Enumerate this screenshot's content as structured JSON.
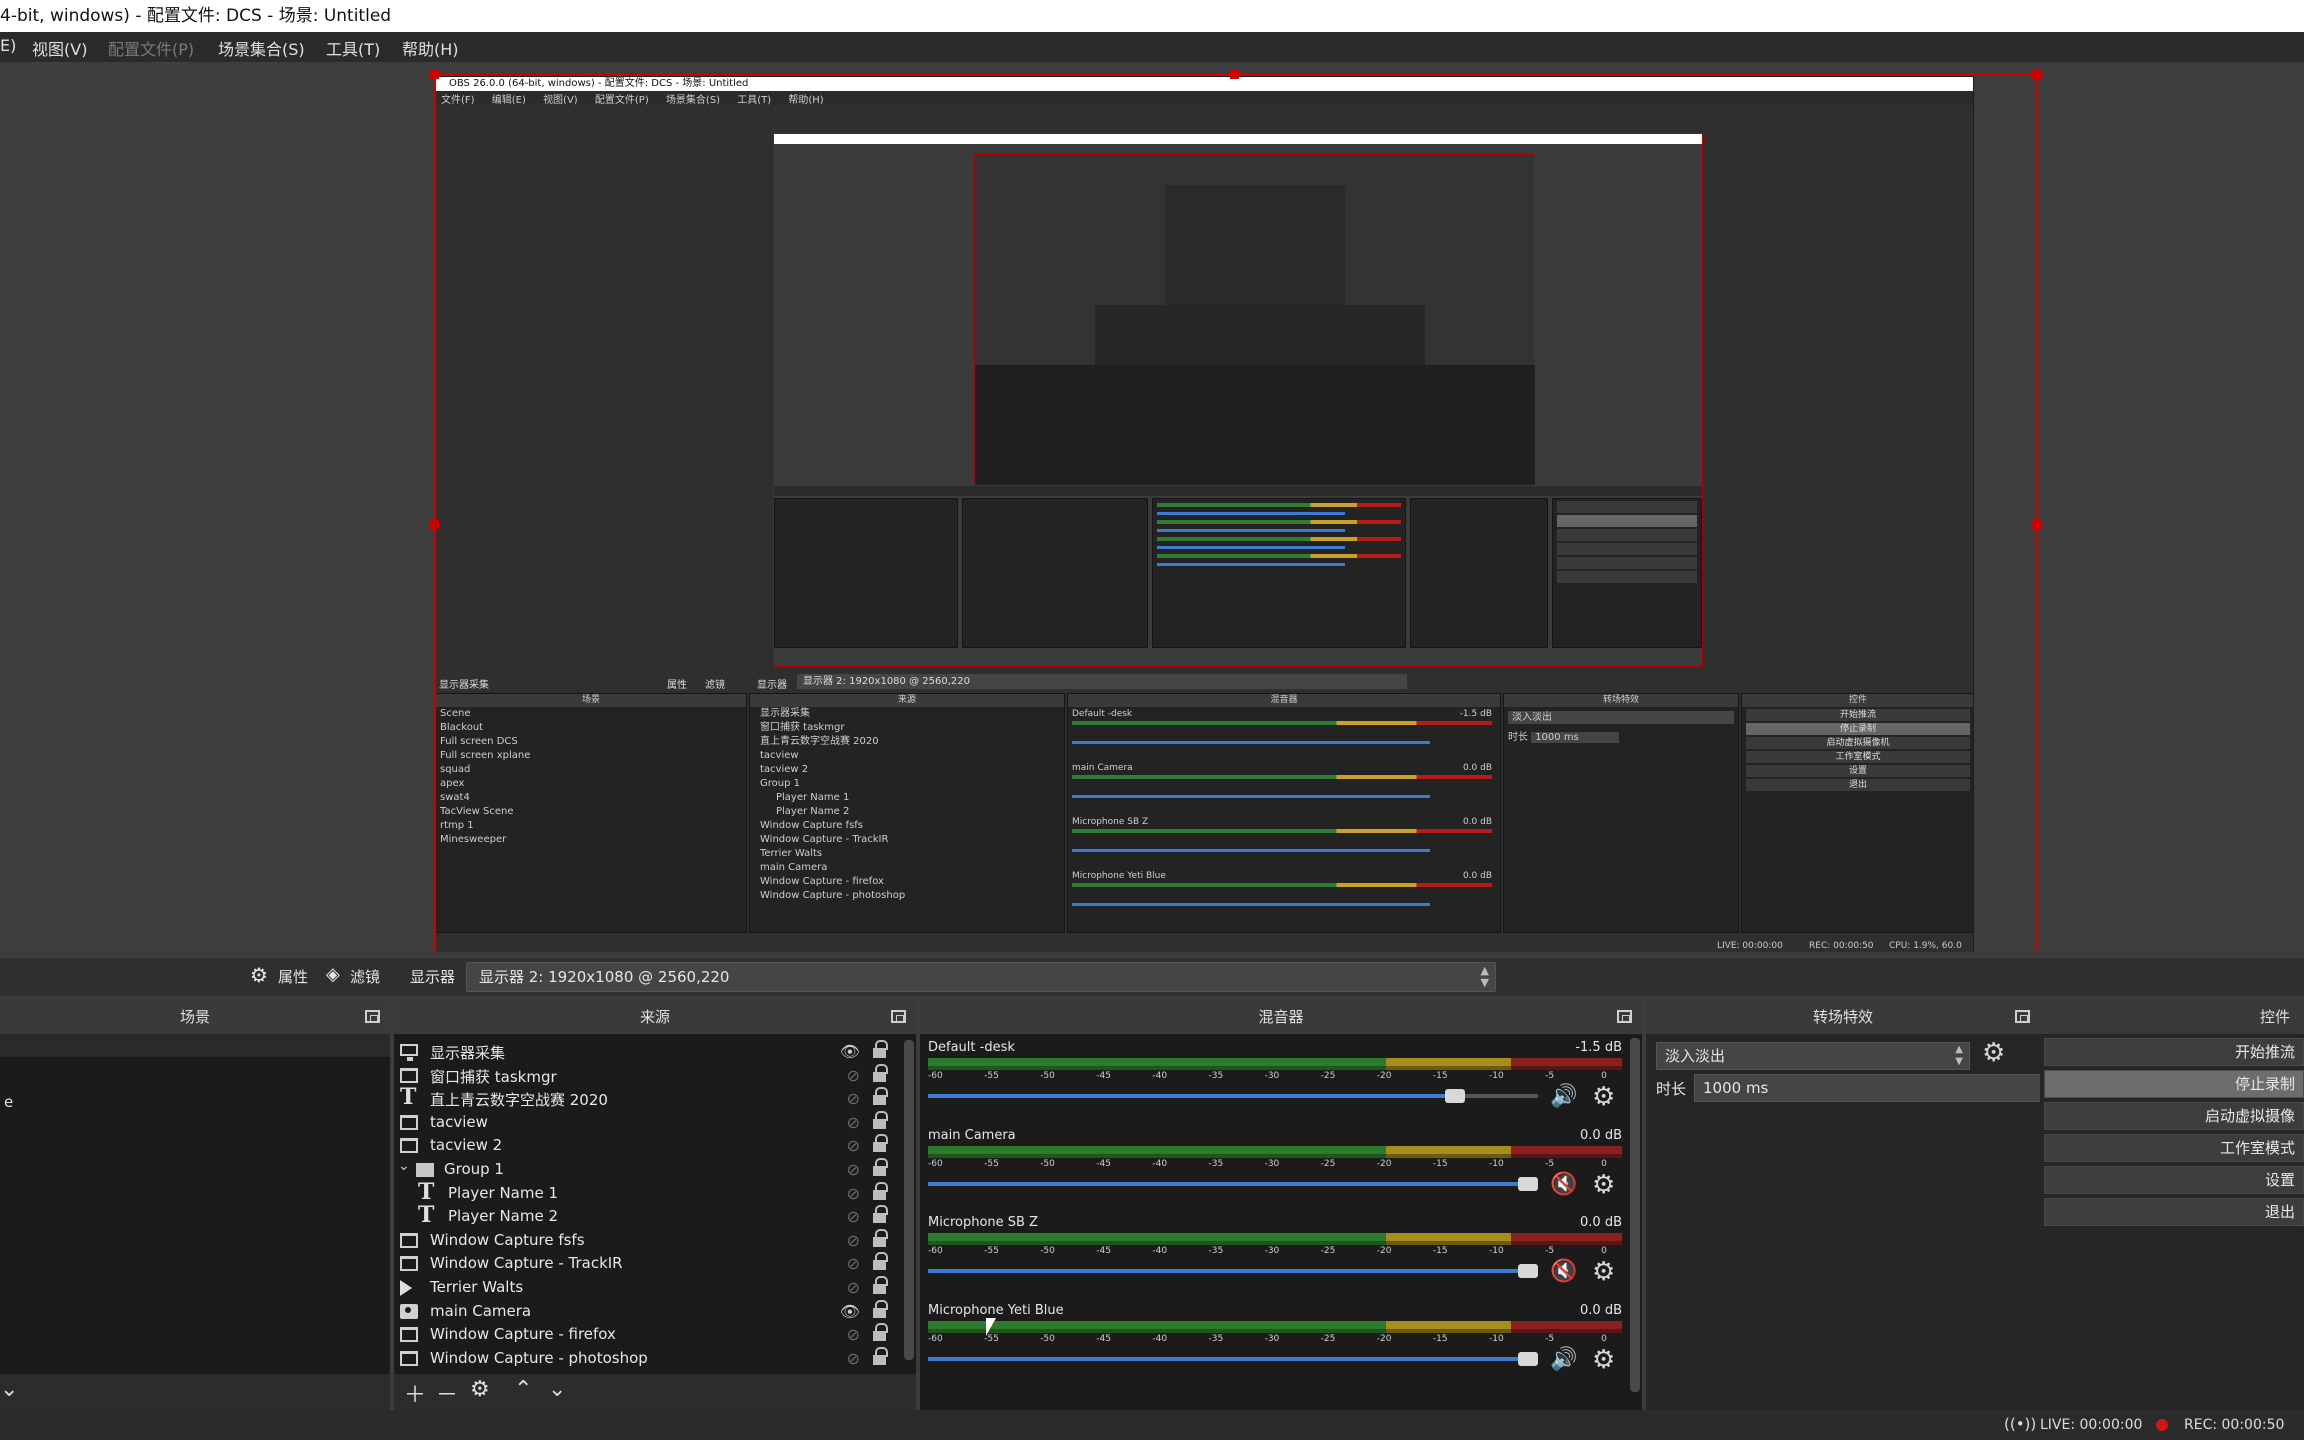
{
  "window": {
    "title": "4-bit, windows) - 配置文件: DCS - 场景: Untitled"
  },
  "menu": [
    {
      "label": "E)",
      "disabled": false
    },
    {
      "label": "视图(V)",
      "disabled": false
    },
    {
      "label": "配置文件(P)",
      "disabled": true
    },
    {
      "label": "场景集合(S)",
      "disabled": false
    },
    {
      "label": "工具(T)",
      "disabled": false
    },
    {
      "label": "帮助(H)",
      "disabled": false
    }
  ],
  "preview": {
    "nested_title": "OBS 26.0.0 (64-bit, windows) - 配置文件: DCS - 场景: Untitled",
    "nested_menu": [
      "文件(F)",
      "编辑(E)",
      "视图(V)",
      "配置文件(P)",
      "场景集合(S)",
      "工具(T)",
      "帮助(H)"
    ],
    "nested_toolbar": {
      "source": "显示器采集",
      "properties": "属性",
      "filters": "滤镜",
      "display": "显示器",
      "display_value": "显示器 2: 1920x1080 @ 2560,220"
    },
    "nested_headers": {
      "scenes": "场景",
      "sources": "来源",
      "mixer": "混音器",
      "transitions": "转场特效",
      "controls": "控件"
    },
    "nested_scenes": [
      "Scene",
      "Blackout",
      "Full screen DCS",
      "Full screen xplane",
      "squad",
      "apex",
      "swat4",
      "TacView    Scene",
      "rtmp 1",
      "Minesweeper"
    ],
    "nested_sources": [
      "显示器采集",
      "窗口捕获 taskmgr",
      "直上青云数字空战赛 2020",
      "tacview",
      "tacview 2",
      "Group 1",
      "Player Name 1",
      "Player Name 2",
      "Window Capture fsfs",
      "Window Capture - TrackIR",
      "Terrier Walts",
      "main Camera",
      "Window Capture - firefox",
      "Window Capture - photoshop"
    ],
    "nested_mixer": [
      {
        "name": "Default -desk",
        "db": "-1.5 dB"
      },
      {
        "name": "main Camera",
        "db": "0.0 dB"
      },
      {
        "name": "Microphone SB Z",
        "db": "0.0 dB"
      },
      {
        "name": "Microphone Yeti Blue",
        "db": "0.0 dB"
      }
    ],
    "nested_transition": {
      "name": "淡入淡出",
      "duration_label": "时长",
      "duration": "1000 ms"
    },
    "nested_controls": [
      "开始推流",
      "停止录制",
      "启动虚拟摄像机",
      "工作室模式",
      "设置",
      "退出"
    ],
    "nested_status": {
      "live": "LIVE: 00:00:00",
      "rec": "REC: 00:00:50",
      "cpu": "CPU: 1.9%, 60.0"
    }
  },
  "toolbar": {
    "properties_label": "属性",
    "filters_label": "滤镜",
    "display_label": "显示器",
    "display_value": "显示器 2: 1920x1080 @ 2560,220"
  },
  "scenes": {
    "title": "场景",
    "items": [
      "e"
    ]
  },
  "sources": {
    "title": "来源",
    "items": [
      {
        "icon": "mon",
        "label": "显示器采集",
        "visible": true,
        "indent": 0
      },
      {
        "icon": "box",
        "label": "窗口捕获 taskmgr",
        "visible": false,
        "indent": 0
      },
      {
        "icon": "txt",
        "label": "直上青云数字空战赛 2020",
        "visible": false,
        "indent": 0
      },
      {
        "icon": "box",
        "label": "tacview",
        "visible": false,
        "indent": 0
      },
      {
        "icon": "box",
        "label": "tacview 2",
        "visible": false,
        "indent": 0
      },
      {
        "icon": "folder",
        "label": "Group 1",
        "visible": false,
        "indent": 0,
        "group": true
      },
      {
        "icon": "txt",
        "label": "Player Name 1",
        "visible": false,
        "indent": 1
      },
      {
        "icon": "txt",
        "label": "Player Name 2",
        "visible": false,
        "indent": 1
      },
      {
        "icon": "box",
        "label": "Window Capture fsfs",
        "visible": false,
        "indent": 0
      },
      {
        "icon": "box",
        "label": "Window Capture - TrackIR",
        "visible": false,
        "indent": 0
      },
      {
        "icon": "play",
        "label": "Terrier Walts",
        "visible": false,
        "indent": 0
      },
      {
        "icon": "cam",
        "label": "main Camera",
        "visible": true,
        "indent": 0
      },
      {
        "icon": "box",
        "label": "Window Capture - firefox",
        "visible": false,
        "indent": 0
      },
      {
        "icon": "box",
        "label": "Window Capture - photoshop",
        "visible": false,
        "indent": 0
      }
    ]
  },
  "mixer": {
    "title": "混音器",
    "ticks": [
      "-60",
      "-55",
      "-50",
      "-45",
      "-40",
      "-35",
      "-30",
      "-25",
      "-20",
      "-15",
      "-10",
      "-5",
      "0"
    ],
    "channels": [
      {
        "name": "Default -desk",
        "db": "-1.5 dB",
        "volume": 0.88,
        "muted": false
      },
      {
        "name": "main Camera",
        "db": "0.0 dB",
        "volume": 1.0,
        "muted": true
      },
      {
        "name": "Microphone SB Z",
        "db": "0.0 dB",
        "volume": 1.0,
        "muted": true
      },
      {
        "name": "Microphone Yeti Blue",
        "db": "0.0 dB",
        "volume": 1.0,
        "muted": false
      }
    ]
  },
  "transitions": {
    "title": "转场特效",
    "selected": "淡入淡出",
    "duration_label": "时长",
    "duration": "1000 ms"
  },
  "controls": {
    "title": "控件",
    "buttons": [
      {
        "label": "开始推流",
        "active": false
      },
      {
        "label": "停止录制",
        "active": true
      },
      {
        "label": "启动虚拟摄像",
        "active": false
      },
      {
        "label": "工作室模式",
        "active": false
      },
      {
        "label": "设置",
        "active": false
      },
      {
        "label": "退出",
        "active": false
      }
    ]
  },
  "status": {
    "live": "LIVE: 00:00:00",
    "rec": "REC: 00:00:50"
  },
  "colors": {
    "accent_red": "#d10000",
    "slider_blue": "#3b7bd4",
    "mute_red": "#d42020"
  }
}
